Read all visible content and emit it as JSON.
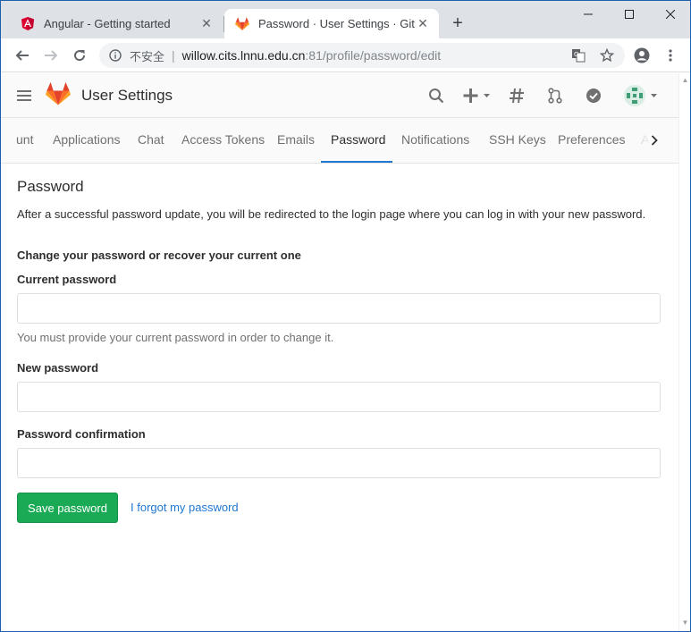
{
  "browser": {
    "tabs": [
      {
        "title": "Angular - Getting started",
        "icon": "angular-icon"
      },
      {
        "title": "Password · User Settings · GitLab",
        "icon": "gitlab-icon"
      }
    ],
    "address": {
      "security_label": "不安全",
      "host": "willow.cits.lnnu.edu.cn",
      "path": ":81/profile/password/edit"
    }
  },
  "header": {
    "title": "User Settings"
  },
  "subnav": {
    "items": [
      "unt",
      "Applications",
      "Chat",
      "Access Tokens",
      "Emails",
      "Password",
      "Notifications",
      "SSH Keys",
      "Preferences",
      "A"
    ],
    "active": "Password"
  },
  "page": {
    "title": "Password",
    "intro": "After a successful password update, you will be redirected to the login page where you can log in with your new password.",
    "subhead": "Change your password or recover your current one",
    "current_label": "Current password",
    "current_value": "",
    "current_help": "You must provide your current password in order to change it.",
    "new_label": "New password",
    "new_value": "",
    "confirm_label": "Password confirmation",
    "confirm_value": "",
    "save_label": "Save password",
    "forgot_label": "I forgot my password"
  },
  "colors": {
    "primary_link": "#1f78d1",
    "save_button": "#1aaa55",
    "gitlab_orange": "#e24329"
  }
}
